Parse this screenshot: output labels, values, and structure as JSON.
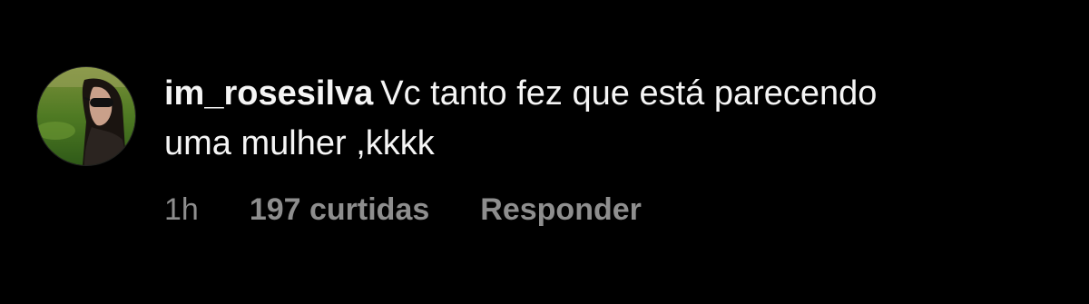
{
  "comment": {
    "username": "im_rosesilva",
    "text_line1": "Vc tanto fez que está parecendo",
    "text_line2": "uma mulher ,kkkk",
    "time": "1h",
    "likes": "197 curtidas",
    "reply_label": "Responder"
  },
  "avatar": {
    "icon": "user-avatar-photo"
  },
  "colors": {
    "background": "#000000",
    "primary_text": "#f5f5f5",
    "secondary_text": "#8e8e8e"
  }
}
